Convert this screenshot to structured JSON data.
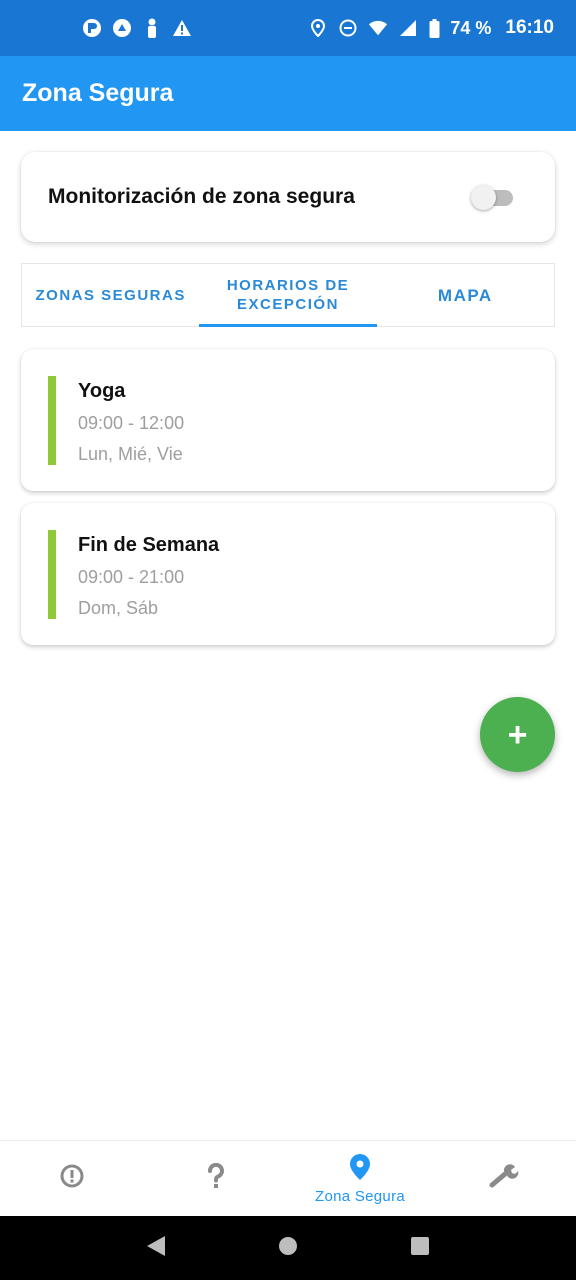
{
  "status_bar": {
    "battery": "74 %",
    "time": "16:10",
    "left_icons": [
      "notification-p-icon",
      "notification-circle-icon",
      "notification-figure-icon",
      "warning-icon"
    ],
    "right_icons": [
      "location-icon",
      "dnd-icon",
      "wifi-icon",
      "signal-icon",
      "battery-icon"
    ]
  },
  "app_bar": {
    "title": "Zona Segura"
  },
  "monitor": {
    "label": "Monitorización de zona segura",
    "enabled": false
  },
  "tabs": [
    {
      "label": "ZONAS SEGURAS",
      "active": false
    },
    {
      "label": "HORARIOS DE EXCEPCIÓN",
      "active": true
    },
    {
      "label": "MAPA",
      "active": false
    }
  ],
  "schedules": [
    {
      "name": "Yoga",
      "time": "09:00 - 12:00",
      "days": "Lun, Mié, Vie"
    },
    {
      "name": "Fin de Semana",
      "time": "09:00 - 21:00",
      "days": "Dom, Sáb"
    }
  ],
  "fab": {
    "label": "+"
  },
  "bottom_nav": {
    "items": [
      {
        "icon": "info-icon",
        "label": ""
      },
      {
        "icon": "help-icon",
        "label": ""
      },
      {
        "icon": "location-pin-icon",
        "label": "Zona Segura",
        "active": true
      },
      {
        "icon": "wrench-icon",
        "label": ""
      }
    ]
  },
  "colors": {
    "status_bar": "#1976d2",
    "app_bar": "#2196f3",
    "tab_text": "#2a8ad6",
    "schedule_bar": "#8fc93a",
    "fab": "#4caf50"
  }
}
